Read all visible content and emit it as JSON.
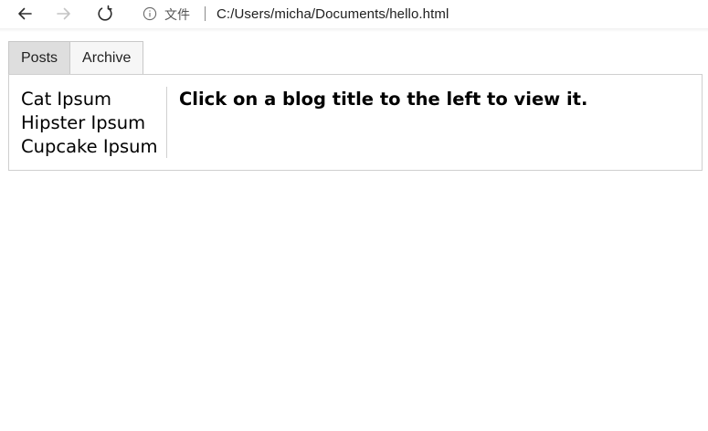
{
  "browser": {
    "address_label": "文件",
    "url": "C:/Users/micha/Documents/hello.html"
  },
  "tabs": [
    {
      "label": "Posts"
    },
    {
      "label": "Archive"
    }
  ],
  "posts": [
    {
      "title": "Cat Ipsum"
    },
    {
      "title": "Hipster Ipsum"
    },
    {
      "title": "Cupcake Ipsum"
    }
  ],
  "viewer": {
    "message": "Click on a blog title to the left to view it."
  }
}
